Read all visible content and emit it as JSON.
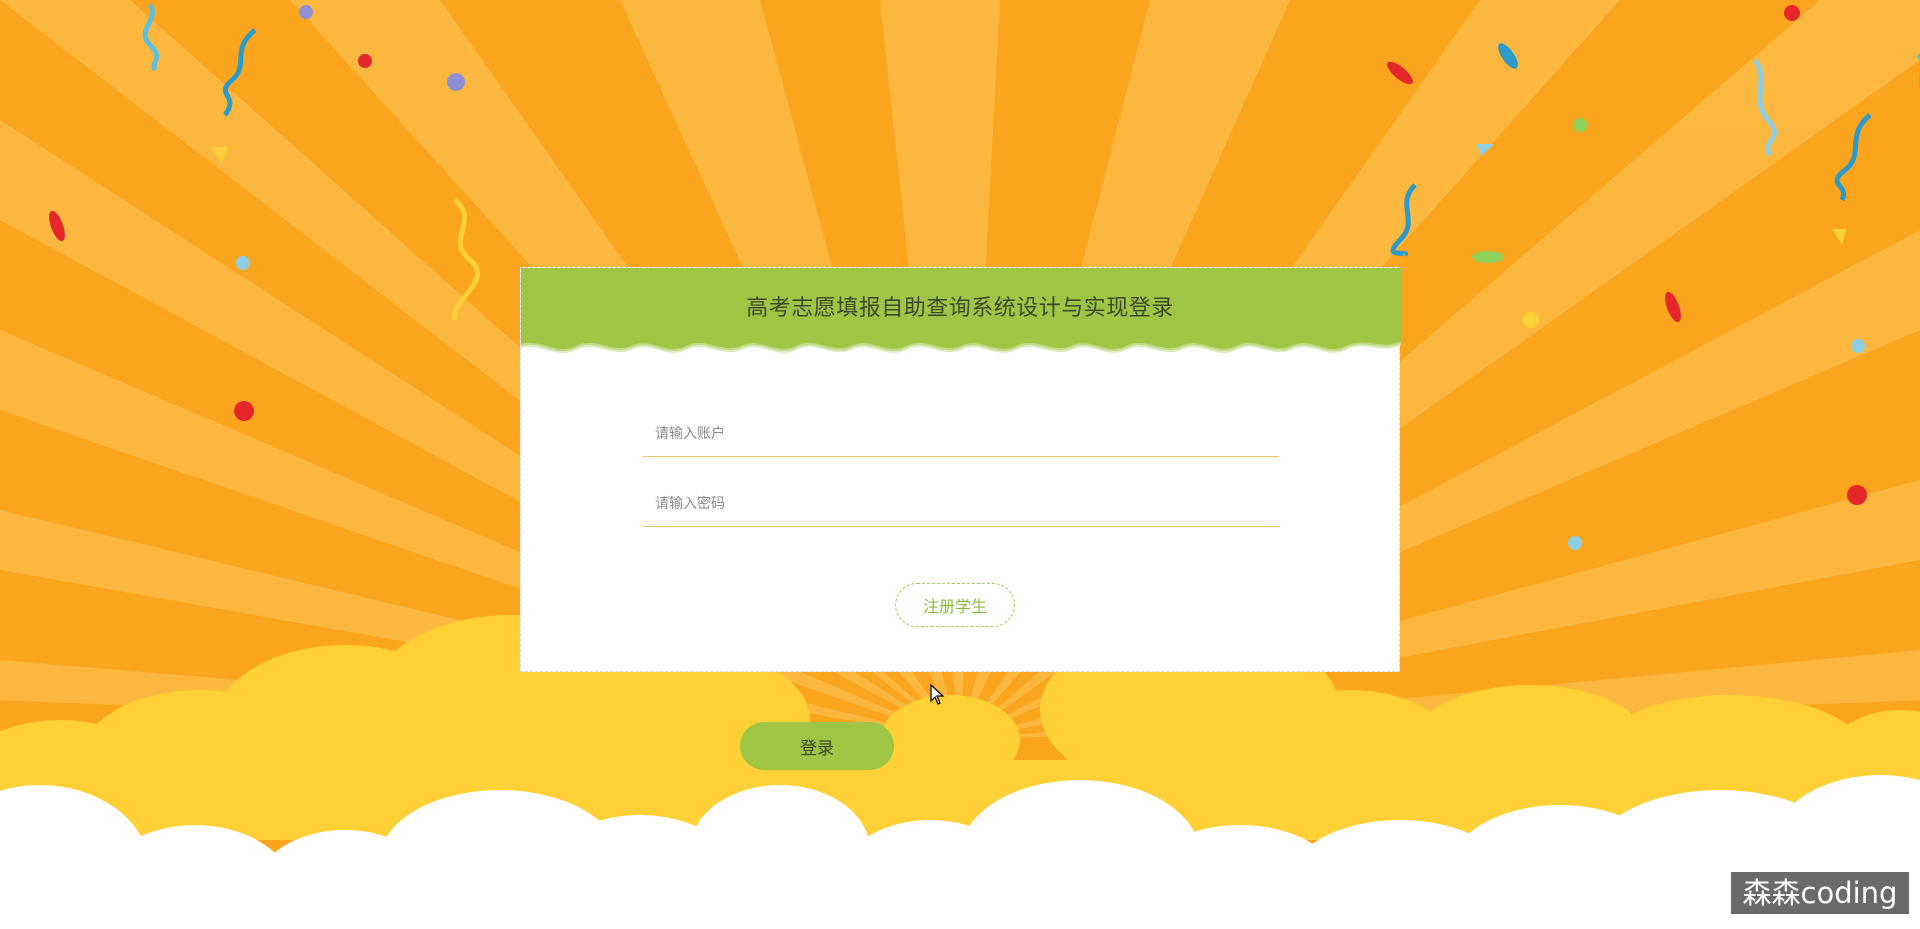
{
  "page": {
    "title": "高考志愿填报自助查询系统设计与实现登录"
  },
  "form": {
    "account_placeholder": "请输入账户",
    "password_placeholder": "请输入密码",
    "register_label": "注册学生",
    "login_label": "登录"
  },
  "watermark": {
    "text": "森森coding"
  },
  "colors": {
    "background": "#fba51e",
    "ray": "#fdbb45",
    "header_green": "#9fc544",
    "cloud_yellow": "#ffd136",
    "cloud_white": "#ffffff",
    "field_underline": "#e9c765",
    "register_text": "#8dbb3c"
  }
}
